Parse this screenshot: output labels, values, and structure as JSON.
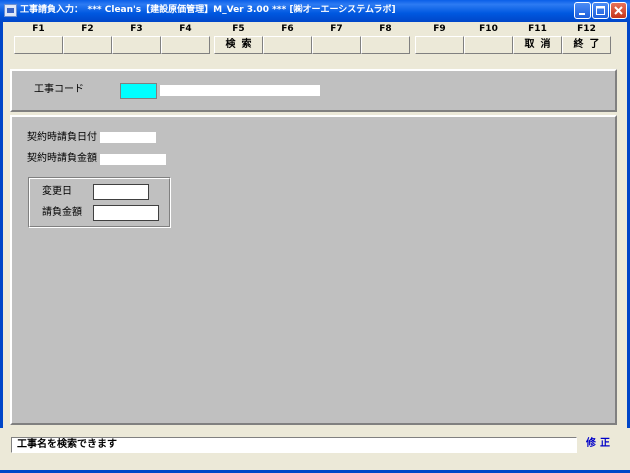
{
  "window": {
    "title": "工事請負入力：　*** Clean's【建設原価管理】M_Ver 3.00 *** [㈱オーエーシステムラボ]",
    "icon": "app-icon",
    "controls": [
      "minimize-icon",
      "maximize-icon",
      "close-icon"
    ]
  },
  "fkeys": [
    {
      "key": "F1",
      "label": ""
    },
    {
      "key": "F2",
      "label": ""
    },
    {
      "key": "F3",
      "label": ""
    },
    {
      "key": "F4",
      "label": ""
    },
    {
      "key": "F5",
      "label": "検索"
    },
    {
      "key": "F6",
      "label": ""
    },
    {
      "key": "F7",
      "label": ""
    },
    {
      "key": "F8",
      "label": ""
    },
    {
      "key": "F9",
      "label": ""
    },
    {
      "key": "F10",
      "label": ""
    },
    {
      "key": "F11",
      "label": "取消"
    },
    {
      "key": "F12",
      "label": "終了"
    }
  ],
  "header": {
    "koji_code_label": "工事コード",
    "koji_code_value": "",
    "koji_name_value": ""
  },
  "main": {
    "contract_date_label": "契約時請負日付",
    "contract_date_value": "",
    "contract_amount_label": "契約時請負金額",
    "contract_amount_value": "",
    "change_group": {
      "change_date_label": "変更日",
      "change_date_value": "",
      "amount_label": "請負金額",
      "amount_value": ""
    }
  },
  "status": {
    "message": "工事名を検索できます",
    "mode": "修正"
  },
  "colors": {
    "title_bar": "#0058e0",
    "panel": "#c0c0c0",
    "window_bg": "#ece9d8",
    "code_field": "#00ffff",
    "mode_text": "#0000c8"
  }
}
